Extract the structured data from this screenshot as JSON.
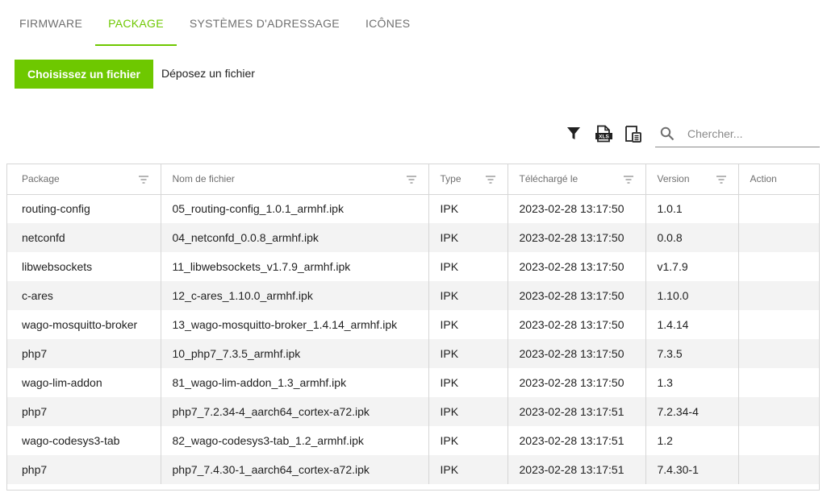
{
  "tabs": [
    {
      "label": "FIRMWARE",
      "active": false
    },
    {
      "label": "PACKAGE",
      "active": true
    },
    {
      "label": "SYSTÈMES D'ADRESSAGE",
      "active": false
    },
    {
      "label": "ICÔNES",
      "active": false
    }
  ],
  "upload": {
    "button_label": "Choisissez un fichier",
    "drop_label": "Déposez un fichier"
  },
  "toolbar": {
    "icons": [
      "filter-icon",
      "export-xls-icon",
      "column-select-icon"
    ],
    "search_placeholder": "Chercher..."
  },
  "table": {
    "columns": [
      "Package",
      "Nom de fichier",
      "Type",
      "Téléchargé le",
      "Version",
      "Action"
    ],
    "rows": [
      {
        "package": "routing-config",
        "filename": "05_routing-config_1.0.1_armhf.ipk",
        "type": "IPK",
        "uploaded": "2023-02-28 13:17:50",
        "version": "1.0.1",
        "action": ""
      },
      {
        "package": "netconfd",
        "filename": "04_netconfd_0.0.8_armhf.ipk",
        "type": "IPK",
        "uploaded": "2023-02-28 13:17:50",
        "version": "0.0.8",
        "action": ""
      },
      {
        "package": "libwebsockets",
        "filename": "11_libwebsockets_v1.7.9_armhf.ipk",
        "type": "IPK",
        "uploaded": "2023-02-28 13:17:50",
        "version": "v1.7.9",
        "action": ""
      },
      {
        "package": "c-ares",
        "filename": "12_c-ares_1.10.0_armhf.ipk",
        "type": "IPK",
        "uploaded": "2023-02-28 13:17:50",
        "version": "1.10.0",
        "action": ""
      },
      {
        "package": "wago-mosquitto-broker",
        "filename": "13_wago-mosquitto-broker_1.4.14_armhf.ipk",
        "type": "IPK",
        "uploaded": "2023-02-28 13:17:50",
        "version": "1.4.14",
        "action": ""
      },
      {
        "package": "php7",
        "filename": "10_php7_7.3.5_armhf.ipk",
        "type": "IPK",
        "uploaded": "2023-02-28 13:17:50",
        "version": "7.3.5",
        "action": ""
      },
      {
        "package": "wago-lim-addon",
        "filename": "81_wago-lim-addon_1.3_armhf.ipk",
        "type": "IPK",
        "uploaded": "2023-02-28 13:17:50",
        "version": "1.3",
        "action": ""
      },
      {
        "package": "php7",
        "filename": "php7_7.2.34-4_aarch64_cortex-a72.ipk",
        "type": "IPK",
        "uploaded": "2023-02-28 13:17:51",
        "version": "7.2.34-4",
        "action": ""
      },
      {
        "package": "wago-codesys3-tab",
        "filename": "82_wago-codesys3-tab_1.2_armhf.ipk",
        "type": "IPK",
        "uploaded": "2023-02-28 13:17:51",
        "version": "1.2",
        "action": ""
      },
      {
        "package": "php7",
        "filename": "php7_7.4.30-1_aarch64_cortex-a72.ipk",
        "type": "IPK",
        "uploaded": "2023-02-28 13:17:51",
        "version": "7.4.30-1",
        "action": ""
      }
    ]
  },
  "colors": {
    "accent": "#6ec800",
    "row_stripe": "#f3f3f3",
    "border": "#d6d6d6"
  }
}
